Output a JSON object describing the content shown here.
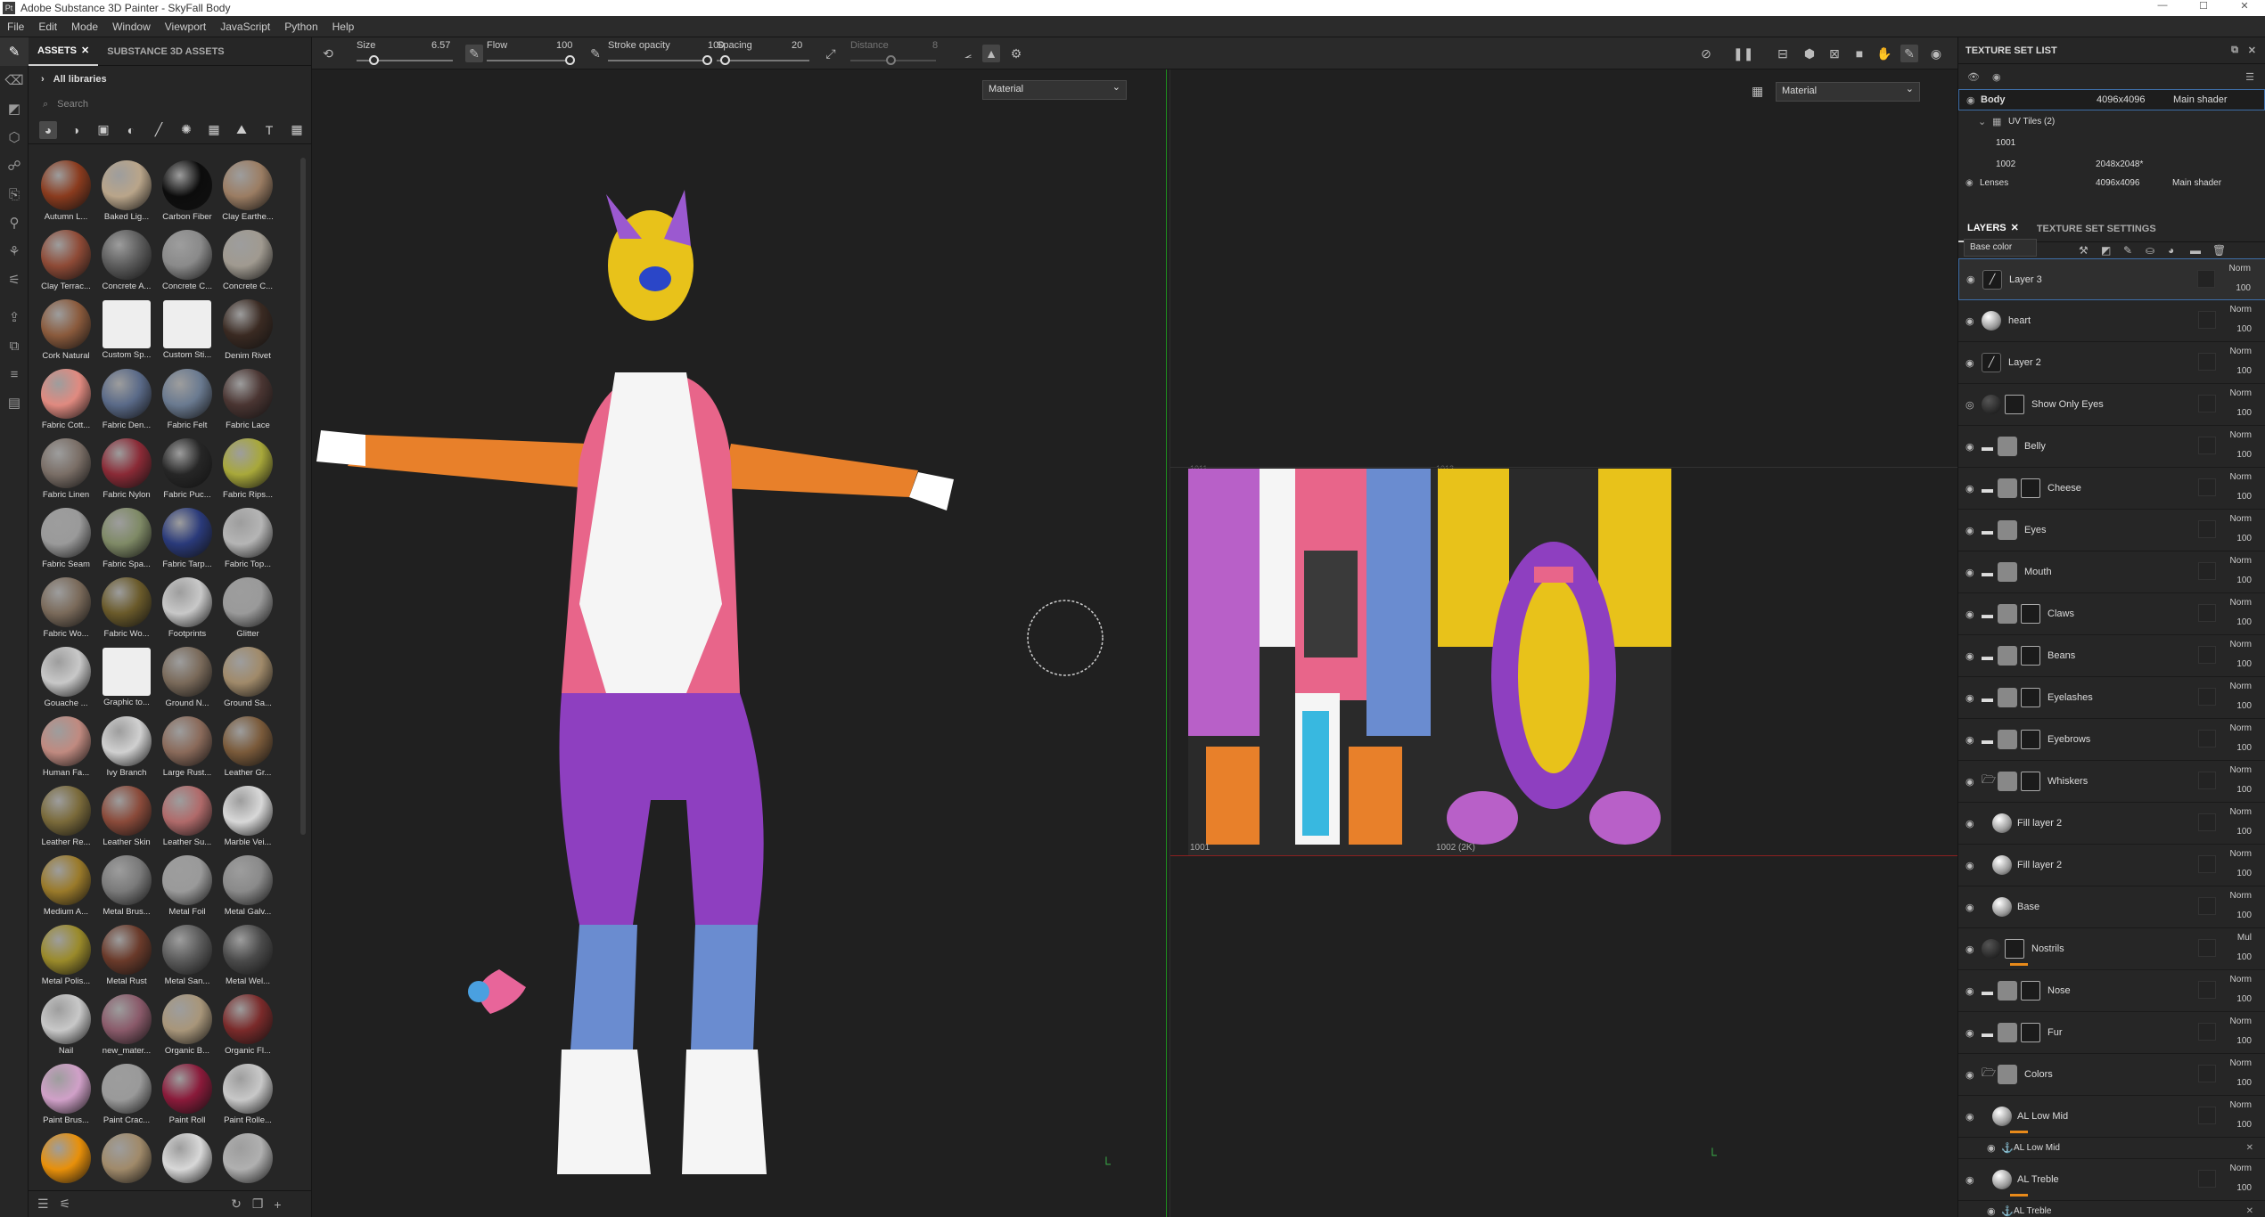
{
  "window": {
    "title": "Adobe Substance 3D Painter - SkyFall Body",
    "logo": "Pt"
  },
  "menu": [
    "File",
    "Edit",
    "Mode",
    "Window",
    "Viewport",
    "JavaScript",
    "Python",
    "Help"
  ],
  "assets": {
    "tabs": [
      "ASSETS",
      "SUBSTANCE 3D ASSETS"
    ],
    "library": "All libraries",
    "search_placeholder": "Search",
    "items": [
      {
        "label": "Autumn L...",
        "color": "#8a3b1e"
      },
      {
        "label": "Baked Lig...",
        "color": "#b9a58a"
      },
      {
        "label": "Carbon Fiber",
        "color": "#0c0c0c"
      },
      {
        "label": "Clay Earthe...",
        "color": "#9b7d63"
      },
      {
        "label": "Clay Terrac...",
        "color": "#8e4a36"
      },
      {
        "label": "Concrete A...",
        "color": "#5c5c5c"
      },
      {
        "label": "Concrete C...",
        "color": "#8a8a8a"
      },
      {
        "label": "Concrete C...",
        "color": "#a09a90"
      },
      {
        "label": "Cork Natural",
        "color": "#8a5a3c"
      },
      {
        "label": "Custom Sp...",
        "color": "#e0e0e0",
        "square": true
      },
      {
        "label": "Custom Sti...",
        "color": "#e0e0e0",
        "square": true
      },
      {
        "label": "Denim Rivet",
        "color": "#3a2a22"
      },
      {
        "label": "Fabric Cott...",
        "color": "#e08a80"
      },
      {
        "label": "Fabric Den...",
        "color": "#5a6a88"
      },
      {
        "label": "Fabric Felt",
        "color": "#6a7a90"
      },
      {
        "label": "Fabric Lace",
        "color": "#4a3532"
      },
      {
        "label": "Fabric Linen",
        "color": "#7a6e66"
      },
      {
        "label": "Fabric Nylon",
        "color": "#8a2a36"
      },
      {
        "label": "Fabric Puc...",
        "color": "#262626"
      },
      {
        "label": "Fabric Rips...",
        "color": "#a8a83a"
      },
      {
        "label": "Fabric Seam",
        "color": "#9a9a9a"
      },
      {
        "label": "Fabric Spa...",
        "color": "#7f8a66"
      },
      {
        "label": "Fabric Tarp...",
        "color": "#2a3a7a"
      },
      {
        "label": "Fabric Top...",
        "color": "#b5b5b5"
      },
      {
        "label": "Fabric Wo...",
        "color": "#7a6a5a"
      },
      {
        "label": "Fabric Wo...",
        "color": "#6a5a2a"
      },
      {
        "label": "Footprints",
        "color": "#c8c8c8"
      },
      {
        "label": "Glitter",
        "color": "#9a9a9a"
      },
      {
        "label": "Gouache ...",
        "color": "#c8c8c8"
      },
      {
        "label": "Graphic to...",
        "color": "#e0e0e0",
        "square": true
      },
      {
        "label": "Ground N...",
        "color": "#7a6a5a"
      },
      {
        "label": "Ground Sa...",
        "color": "#a08a6a"
      },
      {
        "label": "Human Fa...",
        "color": "#c08a80"
      },
      {
        "label": "Ivy Branch",
        "color": "#d0d0d0"
      },
      {
        "label": "Large Rust...",
        "color": "#8a6a5a"
      },
      {
        "label": "Leather Gr...",
        "color": "#7a5a3a"
      },
      {
        "label": "Leather Re...",
        "color": "#7a6a3a"
      },
      {
        "label": "Leather Skin",
        "color": "#8a4a3a"
      },
      {
        "label": "Leather Su...",
        "color": "#b06a6a"
      },
      {
        "label": "Marble Vei...",
        "color": "#d8d8d8"
      },
      {
        "label": "Medium A...",
        "color": "#9a7a2a"
      },
      {
        "label": "Metal Brus...",
        "color": "#7a7a7a"
      },
      {
        "label": "Metal Foil",
        "color": "#9a9a9a"
      },
      {
        "label": "Metal Galv...",
        "color": "#8a8a8a"
      },
      {
        "label": "Metal Polis...",
        "color": "#9a8a2a"
      },
      {
        "label": "Metal Rust",
        "color": "#6a3a2a"
      },
      {
        "label": "Metal San...",
        "color": "#5a5a5a"
      },
      {
        "label": "Metal Wel...",
        "color": "#4a4a4a"
      },
      {
        "label": "Nail",
        "color": "#c8c8c8"
      },
      {
        "label": "new_mater...",
        "color": "#8a5a6a"
      },
      {
        "label": "Organic B...",
        "color": "#a8967a"
      },
      {
        "label": "Organic Fl...",
        "color": "#7a2a2a"
      },
      {
        "label": "Paint Brus...",
        "color": "#d0a0c8"
      },
      {
        "label": "Paint Crac...",
        "color": "#9a9a9a"
      },
      {
        "label": "Paint Roll",
        "color": "#8a1a3a"
      },
      {
        "label": "Paint Rolle...",
        "color": "#c8c8c8"
      },
      {
        "label": "",
        "color": "#e8900a"
      },
      {
        "label": "",
        "color": "#a08a6a"
      },
      {
        "label": "",
        "color": "#d8d8d8"
      },
      {
        "label": "",
        "color": "#b0b0b0"
      }
    ]
  },
  "toolbar": {
    "size_label": "Size",
    "size_value": "6.57",
    "flow_label": "Flow",
    "flow_value": "100",
    "stroke_label": "Stroke opacity",
    "stroke_value": "100",
    "spacing_label": "Spacing",
    "spacing_value": "20",
    "distance_label": "Distance",
    "distance_value": "8"
  },
  "viewport": {
    "left_mode": "Material",
    "right_mode": "Material",
    "uv_tile_left": "1001",
    "uv_tile_right": "1002  (2K)",
    "tile_top_left": "1011",
    "tile_top_right": "1012"
  },
  "texture_set_list": {
    "title": "TEXTURE SET LIST",
    "rows": [
      {
        "name": "Body",
        "res": "4096x4096",
        "shader": "Main shader"
      },
      {
        "name": "UV Tiles (2)",
        "res": "",
        "shader": ""
      },
      {
        "name": "1001",
        "res": "",
        "shader": ""
      },
      {
        "name": "1002",
        "res": "2048x2048*",
        "shader": ""
      },
      {
        "name": "Lenses",
        "res": "4096x4096",
        "shader": "Main shader"
      }
    ]
  },
  "layers_panel": {
    "tabs": [
      "LAYERS",
      "TEXTURE SET SETTINGS"
    ],
    "channel": "Base color",
    "layers": [
      {
        "name": "Layer 3",
        "type": "paint",
        "blend": "Norm",
        "opacity": "100",
        "selected": true
      },
      {
        "name": "heart",
        "type": "fill",
        "blend": "Norm",
        "opacity": "100"
      },
      {
        "name": "Layer 2",
        "type": "paint",
        "blend": "Norm",
        "opacity": "100"
      },
      {
        "name": "Show Only Eyes",
        "type": "fillmask",
        "blend": "Norm",
        "opacity": "100",
        "hidden": true
      },
      {
        "name": "Belly",
        "type": "folder",
        "blend": "Norm",
        "opacity": "100"
      },
      {
        "name": "Cheese",
        "type": "foldermask",
        "blend": "Norm",
        "opacity": "100"
      },
      {
        "name": "Eyes",
        "type": "folder",
        "blend": "Norm",
        "opacity": "100"
      },
      {
        "name": "Mouth",
        "type": "folder",
        "blend": "Norm",
        "opacity": "100"
      },
      {
        "name": "Claws",
        "type": "foldermask",
        "blend": "Norm",
        "opacity": "100"
      },
      {
        "name": "Beans",
        "type": "foldermask",
        "blend": "Norm",
        "opacity": "100"
      },
      {
        "name": "Eyelashes",
        "type": "foldermask",
        "blend": "Norm",
        "opacity": "100"
      },
      {
        "name": "Eyebrows",
        "type": "foldermask",
        "blend": "Norm",
        "opacity": "100"
      },
      {
        "name": "Whiskers",
        "type": "openfoldermask",
        "blend": "Norm",
        "opacity": "100"
      },
      {
        "name": "Fill layer 2",
        "type": "fillind",
        "blend": "Norm",
        "opacity": "100"
      },
      {
        "name": "Fill layer 2",
        "type": "fillind",
        "blend": "Norm",
        "opacity": "100"
      },
      {
        "name": "Base",
        "type": "fillind",
        "blend": "Norm",
        "opacity": "100"
      },
      {
        "name": "Nostrils",
        "type": "fillmask",
        "blend": "Mul",
        "opacity": "100",
        "orange": true
      },
      {
        "name": "Nose",
        "type": "foldermask",
        "blend": "Norm",
        "opacity": "100"
      },
      {
        "name": "Fur",
        "type": "foldermask",
        "blend": "Norm",
        "opacity": "100"
      },
      {
        "name": "Colors",
        "type": "openfolder",
        "blend": "Norm",
        "opacity": "100"
      },
      {
        "name": "AL Low Mid",
        "type": "fillind",
        "blend": "Norm",
        "opacity": "100",
        "orange": true
      },
      {
        "name": "AL Low Mid",
        "type": "anchor",
        "blend": "",
        "opacity": ""
      },
      {
        "name": "AL Treble",
        "type": "fillind",
        "blend": "Norm",
        "opacity": "100",
        "orange": true
      },
      {
        "name": "AL Treble",
        "type": "anchor",
        "blend": "",
        "opacity": ""
      }
    ]
  },
  "colors": {
    "accent": "#3e6ea8",
    "orange": "#e88a1a",
    "green": "#1e8e1e"
  }
}
